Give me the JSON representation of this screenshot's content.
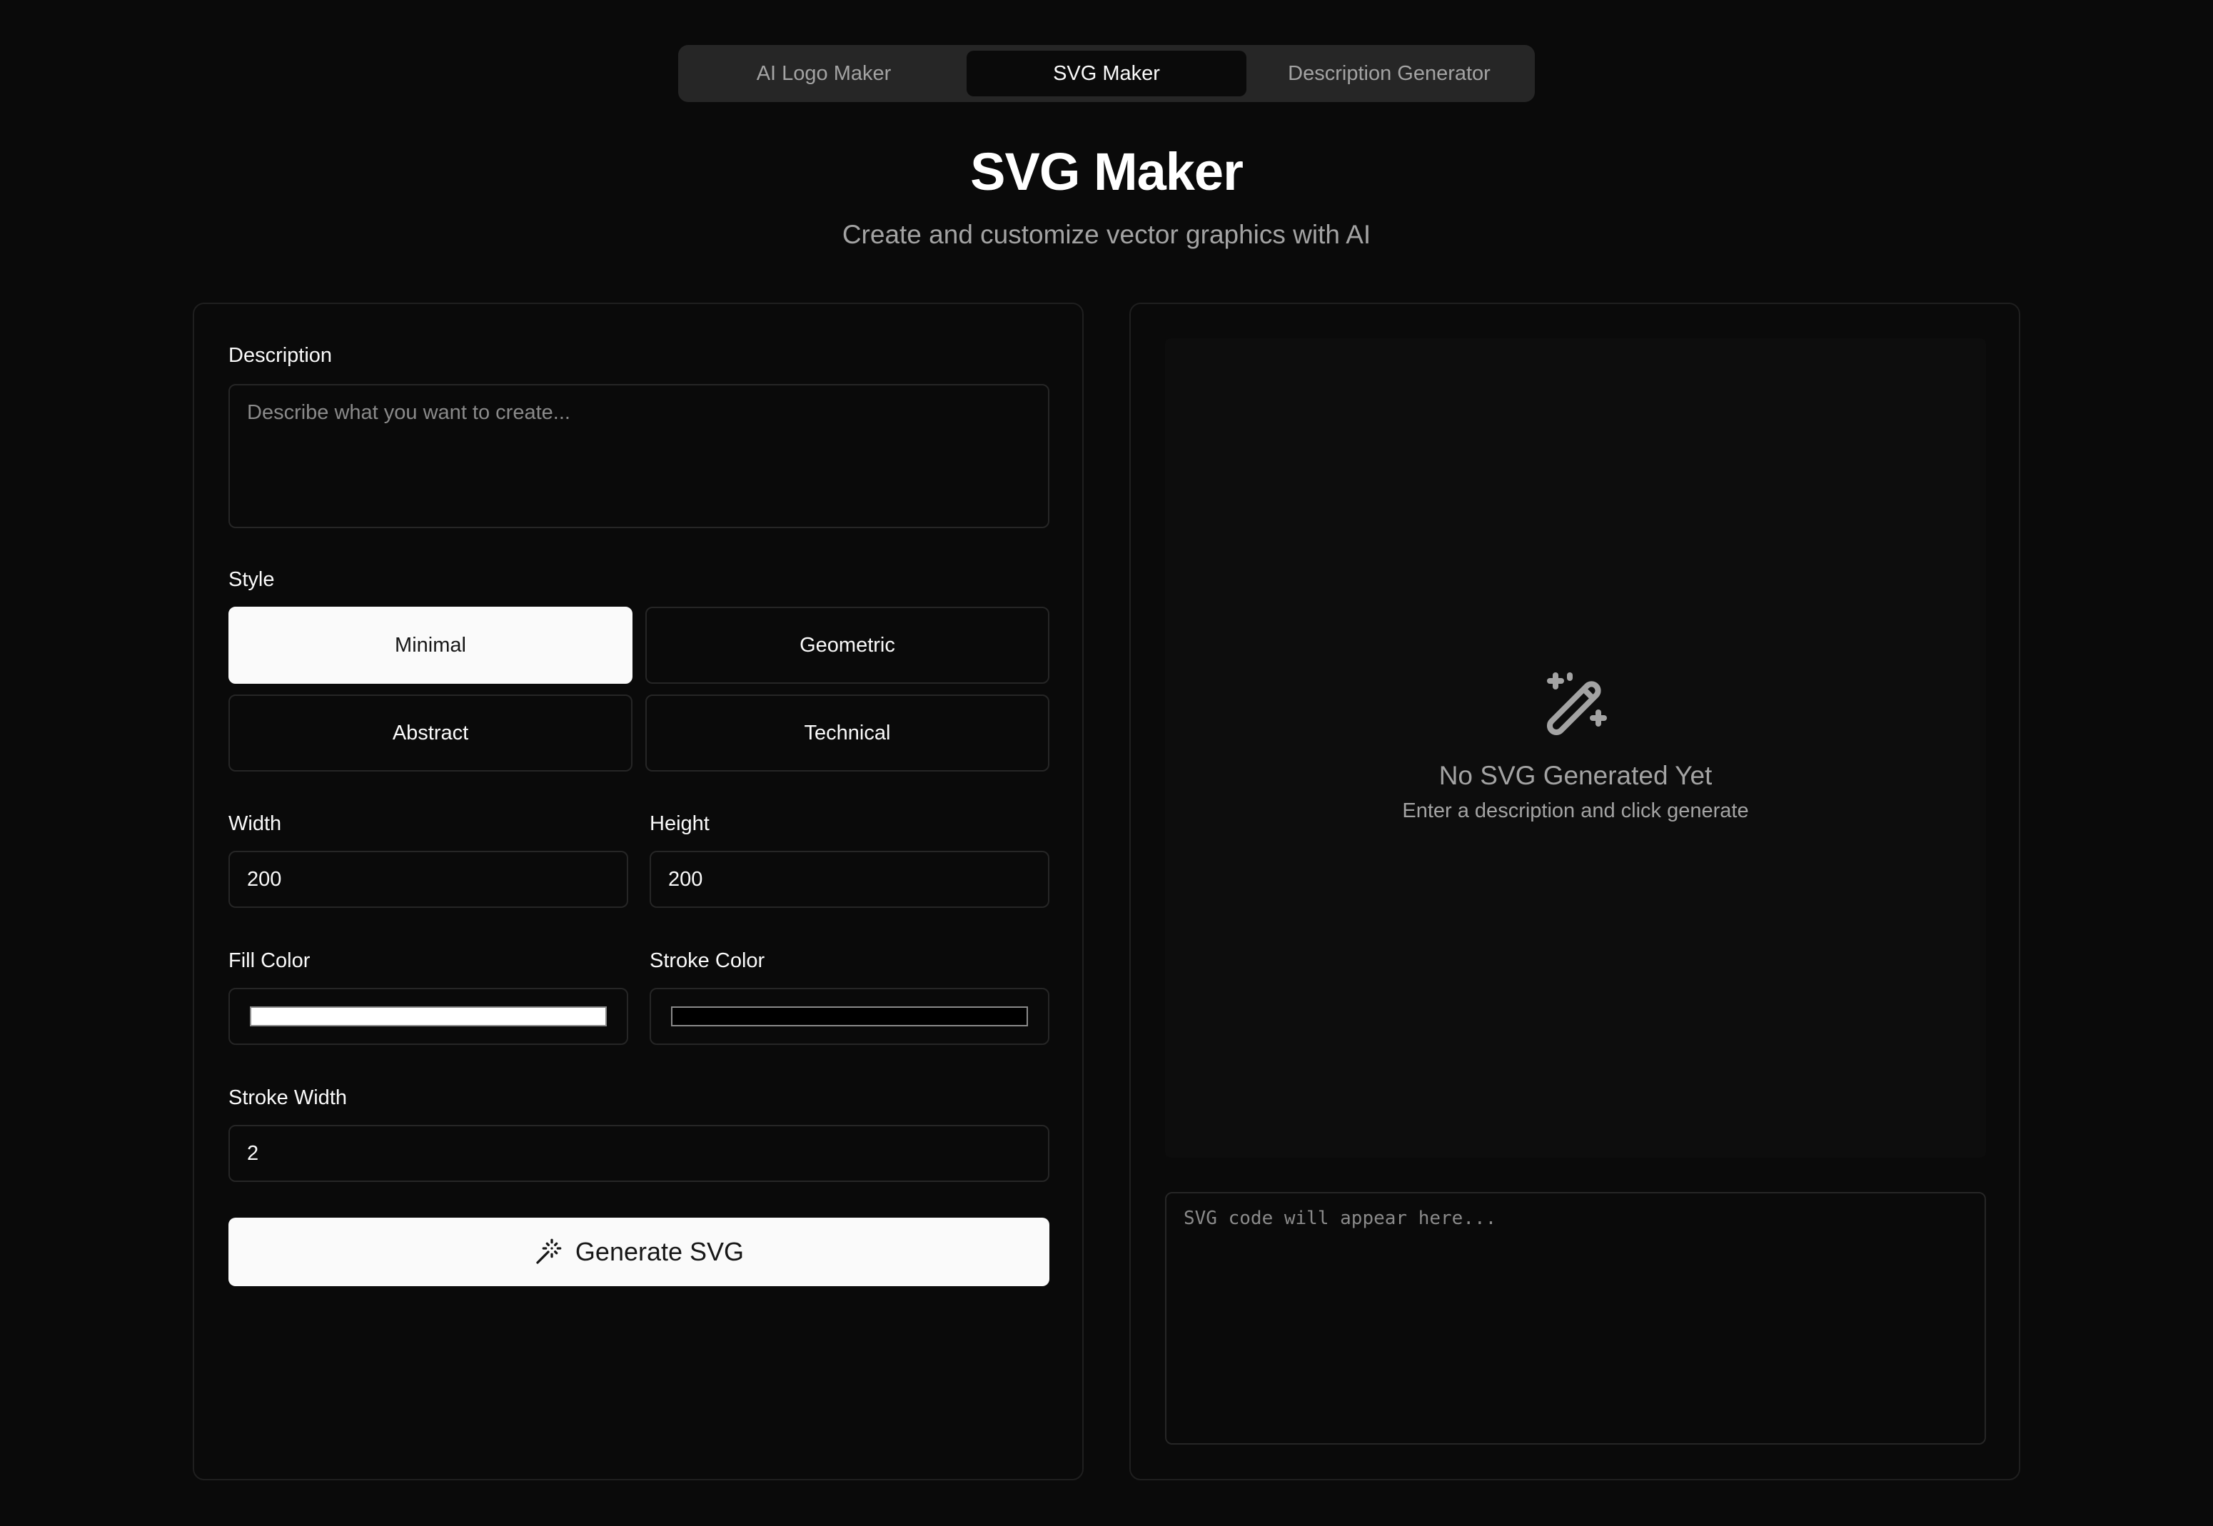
{
  "tabs": [
    {
      "label": "AI Logo Maker",
      "active": false
    },
    {
      "label": "SVG Maker",
      "active": true
    },
    {
      "label": "Description Generator",
      "active": false
    }
  ],
  "header": {
    "title": "SVG Maker",
    "subtitle": "Create and customize vector graphics with AI"
  },
  "form": {
    "description_label": "Description",
    "description_placeholder": "Describe what you want to create...",
    "style_label": "Style",
    "styles": [
      {
        "label": "Minimal",
        "selected": true
      },
      {
        "label": "Geometric",
        "selected": false
      },
      {
        "label": "Abstract",
        "selected": false
      },
      {
        "label": "Technical",
        "selected": false
      }
    ],
    "width_label": "Width",
    "width_value": "200",
    "height_label": "Height",
    "height_value": "200",
    "fill_color_label": "Fill Color",
    "fill_color": "#ffffff",
    "stroke_color_label": "Stroke Color",
    "stroke_color": "#000000",
    "stroke_width_label": "Stroke Width",
    "stroke_width_value": "2",
    "generate_label": "Generate SVG",
    "generate_icon": "magic-wand-icon"
  },
  "preview": {
    "empty_icon": "magic-wand-icon",
    "empty_title": "No SVG Generated Yet",
    "empty_subtitle": "Enter a description and click generate",
    "code_placeholder": "SVG code will appear here..."
  },
  "colors": {
    "background": "#0a0a0a",
    "primary": "#fafafa",
    "muted": "#a3a3a3",
    "border": "#262626"
  }
}
